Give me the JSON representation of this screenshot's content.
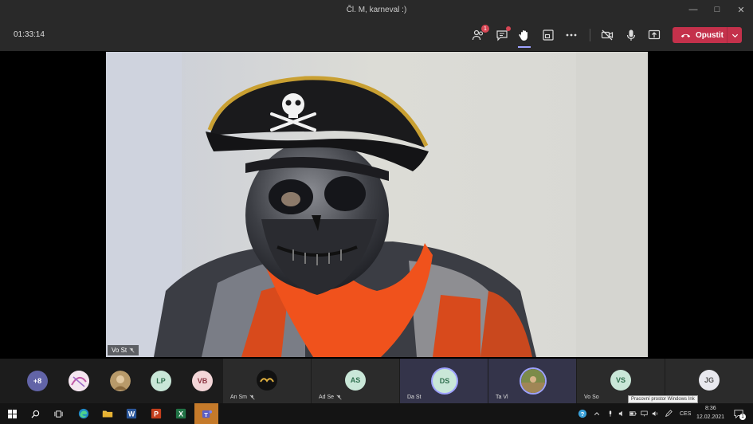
{
  "window": {
    "title": "Čl. M, karneval :)"
  },
  "toolbar": {
    "timer": "01:33:14",
    "participants_badge": "1",
    "leave_label": "Opustit"
  },
  "video": {
    "name": "Vo St"
  },
  "roster": {
    "overflow": "+8",
    "avatars": [
      {
        "initials": "LP",
        "bg": "#c9e7d8",
        "fg": "#2f6f4e"
      },
      {
        "initials": "VB",
        "bg": "#f3d6d8",
        "fg": "#8a3340"
      }
    ],
    "tiles": [
      {
        "name": "An Sm",
        "initials": "",
        "mic": "muted"
      },
      {
        "name": "Ad Se",
        "initials": "AS",
        "bg": "#c9e7d8",
        "fg": "#2f6f4e"
      },
      {
        "name": "Da St",
        "initials": "DS",
        "bg": "#c9e7d8",
        "fg": "#2f6f4e"
      },
      {
        "name": "Ta Vl",
        "initials": ""
      },
      {
        "name": "Vo So",
        "initials": "VS",
        "bg": "#c9e7d8",
        "fg": "#2f6f4e"
      },
      {
        "name": "",
        "initials": "JG",
        "bg": "#e8e8ee",
        "fg": "#555"
      }
    ],
    "tooltip": "Pracovní prostor Windows Ink"
  },
  "taskbar": {
    "lang": "CES",
    "time": "8:36",
    "date": "12.02.2021",
    "notif_count": "1"
  },
  "colors": {
    "leave": "#c4314b",
    "accent": "#9ea2ff",
    "overflow": "#6264a7"
  }
}
